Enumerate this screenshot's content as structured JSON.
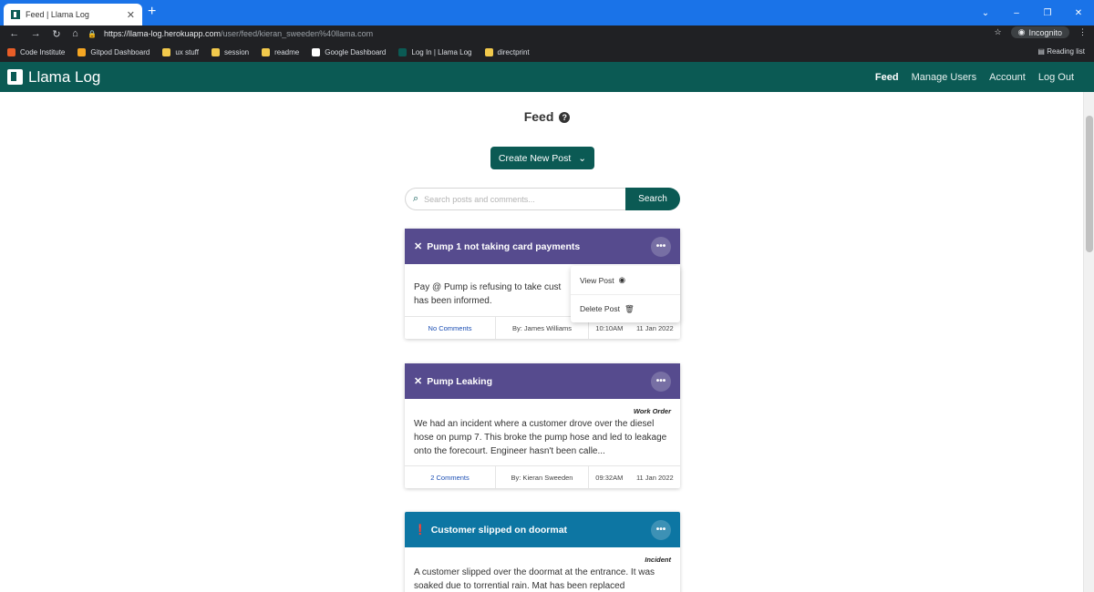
{
  "browser": {
    "tab_title": "Feed | Llama Log",
    "url_host": "https://llama-log.herokuapp.com",
    "url_path": "/user/feed/kieran_sweeden%40llama.com",
    "incognito_label": "Incognito",
    "bookmarks": [
      "Code Institute",
      "Gitpod Dashboard",
      "ux stuff",
      "session",
      "readme",
      "Google Dashboard",
      "Log In | Llama Log",
      "directprint"
    ],
    "reading_list": "Reading list"
  },
  "app": {
    "brand": "Llama Log",
    "nav": {
      "feed": "Feed",
      "manage_users": "Manage Users",
      "account": "Account",
      "logout": "Log Out"
    },
    "page_title": "Feed",
    "create_button": "Create New Post",
    "search_placeholder": "Search posts and comments...",
    "search_button": "Search"
  },
  "dropdown": {
    "view": "View Post",
    "delete": "Delete Post"
  },
  "posts": [
    {
      "title": "Pump 1 not taking card payments",
      "color": "#564b8e",
      "type": "",
      "body": "Pay @ Pump is refusing to take cust... has been informed.",
      "body_visible_1": "Pay @ Pump is refusing to take cust",
      "body_visible_2": "has been informed.",
      "comments": "No Comments",
      "author": "By: James Williams",
      "time": "10:10AM",
      "date": "11 Jan 2022"
    },
    {
      "title": "Pump Leaking",
      "color": "#564b8e",
      "type": "Work Order",
      "body": "We had an incident where a customer drove over the diesel hose on pump 7. This broke the pump hose and led to leakage onto the forecourt. Engineer hasn't been calle...",
      "comments": "2 Comments",
      "author": "By: Kieran Sweeden",
      "time": "09:32AM",
      "date": "11 Jan 2022"
    },
    {
      "title": "Customer slipped on doormat",
      "color": "#0d76a3",
      "type": "Incident",
      "body": "A customer slipped over the doormat at the entrance. It was soaked due to torrential rain. Mat has been replaced"
    }
  ]
}
